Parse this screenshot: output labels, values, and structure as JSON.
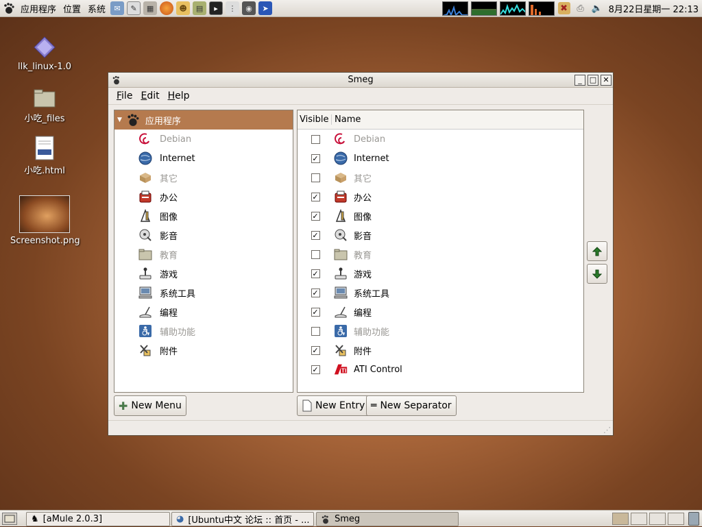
{
  "top_panel": {
    "menus": [
      "应用程序",
      "位置",
      "系统"
    ],
    "clock": "8月22日星期一 22:13"
  },
  "desktop_icons": [
    {
      "label": "llk_linux-1.0",
      "icon": "diamond-icon"
    },
    {
      "label": "小吃_files",
      "icon": "folder-icon"
    },
    {
      "label": "小吃.html",
      "icon": "html-file-icon"
    },
    {
      "label": "Screenshot.png",
      "icon": "image-thumbnail-icon"
    }
  ],
  "window": {
    "title": "Smeg",
    "menu": [
      "File",
      "Edit",
      "Help"
    ],
    "tree": {
      "root": "应用程序",
      "items": [
        {
          "label": "Debian",
          "icon": "debian-icon",
          "disabled": true
        },
        {
          "label": "Internet",
          "icon": "globe-icon",
          "disabled": false
        },
        {
          "label": "其它",
          "icon": "box-icon",
          "disabled": true
        },
        {
          "label": "办公",
          "icon": "office-icon",
          "disabled": false
        },
        {
          "label": "图像",
          "icon": "graphics-icon",
          "disabled": false
        },
        {
          "label": "影音",
          "icon": "multimedia-icon",
          "disabled": false
        },
        {
          "label": "教育",
          "icon": "folder-icon",
          "disabled": true
        },
        {
          "label": "游戏",
          "icon": "joystick-icon",
          "disabled": false
        },
        {
          "label": "系统工具",
          "icon": "computer-icon",
          "disabled": false
        },
        {
          "label": "编程",
          "icon": "programming-icon",
          "disabled": false
        },
        {
          "label": "辅助功能",
          "icon": "accessibility-icon",
          "disabled": true
        },
        {
          "label": "附件",
          "icon": "accessories-icon",
          "disabled": false
        }
      ]
    },
    "list": {
      "col_visible": "Visible",
      "col_name": "Name",
      "rows": [
        {
          "name": "Debian",
          "icon": "debian-icon",
          "visible": false
        },
        {
          "name": "Internet",
          "icon": "globe-icon",
          "visible": true
        },
        {
          "name": "其它",
          "icon": "box-icon",
          "visible": false
        },
        {
          "name": "办公",
          "icon": "office-icon",
          "visible": true
        },
        {
          "name": "图像",
          "icon": "graphics-icon",
          "visible": true
        },
        {
          "name": "影音",
          "icon": "multimedia-icon",
          "visible": true
        },
        {
          "name": "教育",
          "icon": "folder-icon",
          "visible": false
        },
        {
          "name": "游戏",
          "icon": "joystick-icon",
          "visible": true
        },
        {
          "name": "系统工具",
          "icon": "computer-icon",
          "visible": true
        },
        {
          "name": "编程",
          "icon": "programming-icon",
          "visible": true
        },
        {
          "name": "辅助功能",
          "icon": "accessibility-icon",
          "visible": false
        },
        {
          "name": "附件",
          "icon": "accessories-icon",
          "visible": true
        },
        {
          "name": "ATI Control",
          "icon": "ati-icon",
          "visible": true
        }
      ]
    },
    "buttons": {
      "new_menu": "New Menu",
      "new_entry": "New Entry",
      "new_separator": "New Separator"
    }
  },
  "taskbar": {
    "tasks": [
      "[aMule 2.0.3]",
      "[Ubuntu中文 论坛 :: 首页 - ...",
      "Smeg"
    ]
  }
}
